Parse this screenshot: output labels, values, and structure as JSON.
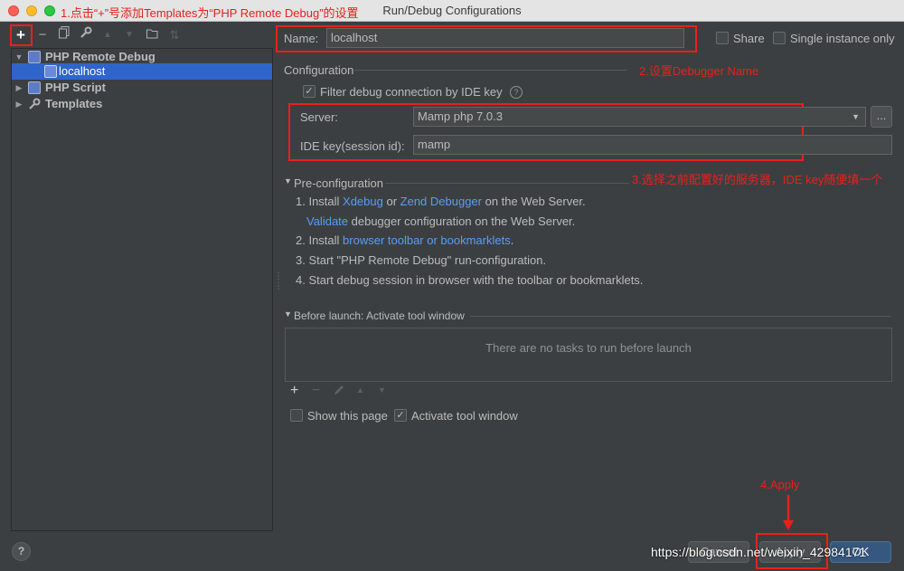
{
  "window": {
    "title": "Run/Debug Configurations"
  },
  "annotations": {
    "step1": "1.点击“+”号添加Templates为“PHP Remote Debug”的设置",
    "step2": "2.设置Debugger Name",
    "step3": "3.选择之前配置好的服务器，IDE key随便填一个",
    "step4": "4.Apply"
  },
  "toolbar": {
    "add": "+",
    "remove": "−",
    "copy": "⧉",
    "edit": "🔧",
    "up": "▲",
    "down": "▼",
    "folder": "📁",
    "sort": "⇅"
  },
  "tree": {
    "items": [
      {
        "label": "PHP Remote Debug",
        "arrow": "▼"
      },
      {
        "label": "localhost"
      },
      {
        "label": "PHP Script",
        "arrow": "▶"
      },
      {
        "label": "Templates",
        "arrow": "▶"
      }
    ]
  },
  "form": {
    "name_label": "Name:",
    "name_value": "localhost",
    "share_label": "Share",
    "single_instance_label": "Single instance only",
    "configuration_label": "Configuration",
    "filter_label": "Filter debug connection by IDE key",
    "help": "?",
    "server_label": "Server:",
    "server_value": "Mamp php 7.0.3",
    "browse_button": "...",
    "idekey_label": "IDE key(session id):",
    "idekey_value": "mamp"
  },
  "preconfig": {
    "heading": "Pre-configuration",
    "step1_prefix": "1. Install ",
    "step1_link1": "Xdebug",
    "step1_or": " or ",
    "step1_link2": "Zend Debugger",
    "step1_suffix": " on the Web Server.",
    "step1b_link": "Validate",
    "step1b_suffix": " debugger configuration on the Web Server.",
    "step2_prefix": "2. Install ",
    "step2_link": "browser toolbar or bookmarklets",
    "step2_suffix": ".",
    "step3": "3. Start \"PHP Remote Debug\" run-configuration.",
    "step4": "4. Start debug session in browser with the toolbar or bookmarklets."
  },
  "before_launch": {
    "heading": "Before launch: Activate tool window",
    "empty_text": "There are no tasks to run before launch",
    "show_page_label": "Show this page",
    "activate_label": "Activate tool window"
  },
  "buttons": {
    "cancel": "Cancel",
    "apply": "Apply",
    "ok": "OK"
  },
  "footer": {
    "help": "?",
    "watermark": "https://blog.csdn.net/weixin_42984171"
  },
  "colors": {
    "background": "#3c3f41",
    "selection": "#2f65ca",
    "link": "#589df6",
    "annotation": "#e8201c",
    "primary_button": "#365880"
  }
}
